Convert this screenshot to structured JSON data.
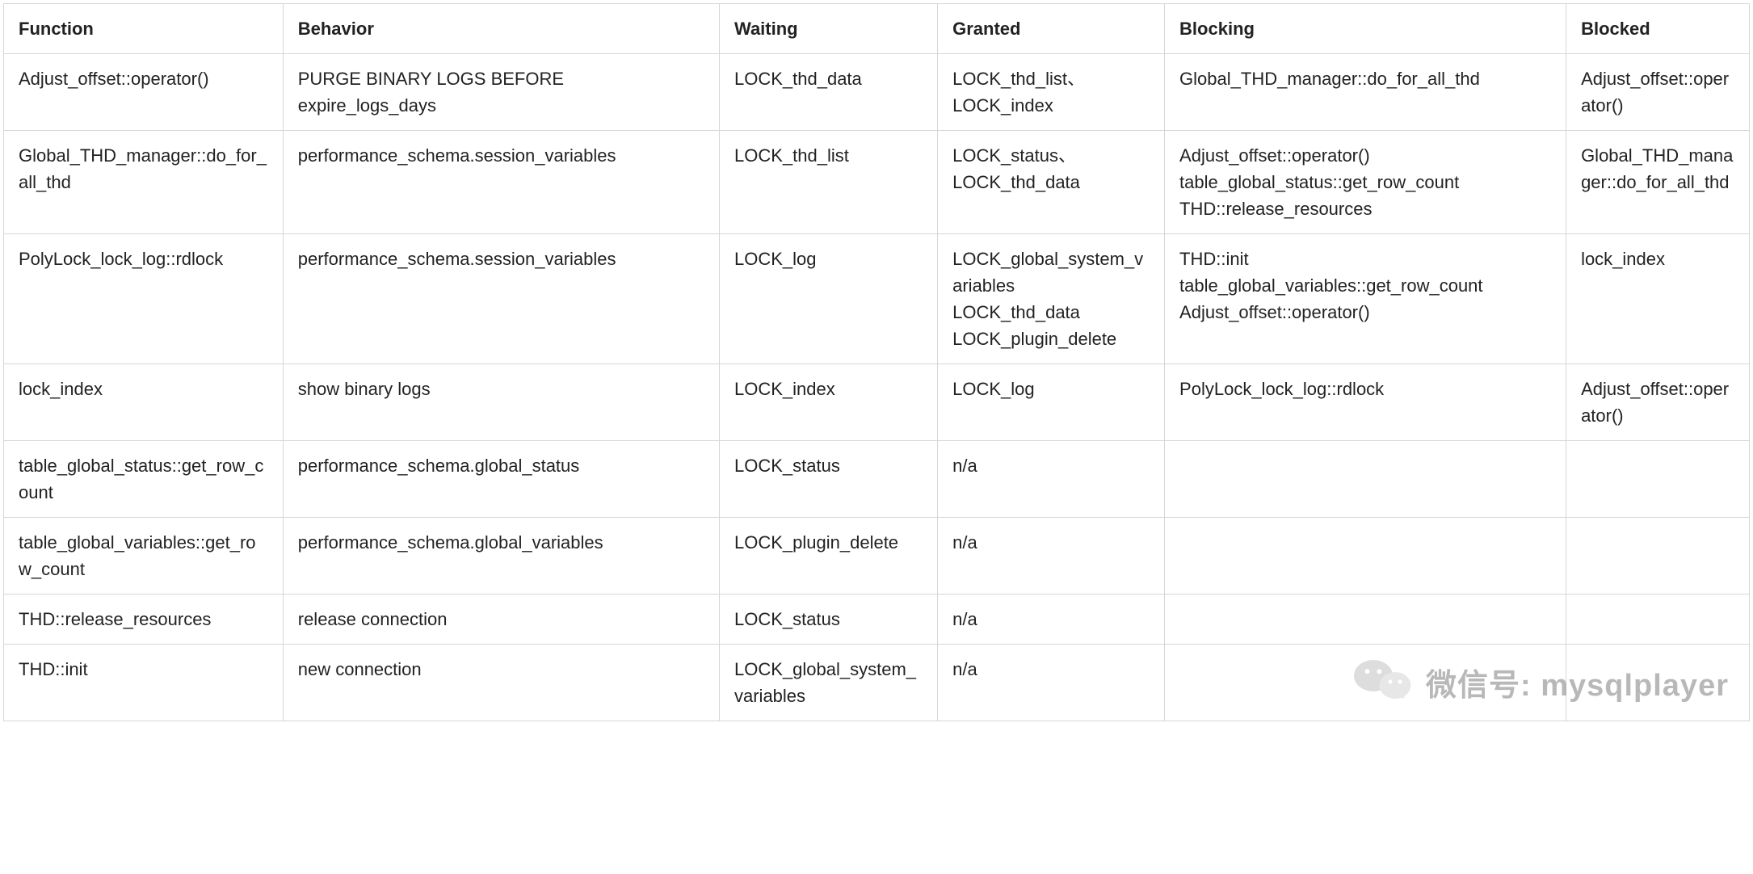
{
  "table": {
    "headers": {
      "function": "Function",
      "behavior": "Behavior",
      "waiting": "Waiting",
      "granted": "Granted",
      "blocking": "Blocking",
      "blocked": "Blocked"
    },
    "rows": [
      {
        "function": "Adjust_offset::operator()",
        "behavior": "PURGE BINARY LOGS BEFORE expire_logs_days",
        "waiting": "LOCK_thd_data",
        "granted": "LOCK_thd_list、LOCK_index",
        "blocking": "Global_THD_manager::do_for_all_thd",
        "blocked": "Adjust_offset::operator()"
      },
      {
        "function": "Global_THD_manager::do_for_all_thd",
        "behavior": "performance_schema.session_variables",
        "waiting": "LOCK_thd_list",
        "granted": "LOCK_status、LOCK_thd_data",
        "blocking_lines": [
          "Adjust_offset::operator()",
          "table_global_status::get_row_count",
          "THD::release_resources"
        ],
        "blocked": "Global_THD_manager::do_for_all_thd"
      },
      {
        "function": "PolyLock_lock_log::rdlock",
        "behavior": "performance_schema.session_variables",
        "waiting": "LOCK_log",
        "granted_lines": [
          "LOCK_global_system_variables",
          "LOCK_thd_data",
          "LOCK_plugin_delete"
        ],
        "blocking_lines": [
          "THD::init",
          "table_global_variables::get_row_count",
          "Adjust_offset::operator()"
        ],
        "blocked": "lock_index"
      },
      {
        "function": "lock_index",
        "behavior": "show binary logs",
        "waiting": "LOCK_index",
        "granted": "LOCK_log",
        "blocking": "PolyLock_lock_log::rdlock",
        "blocked": "Adjust_offset::operator()"
      },
      {
        "function": "table_global_status::get_row_count",
        "behavior": "performance_schema.global_status",
        "waiting": "LOCK_status",
        "granted": "n/a",
        "blocking": "",
        "blocked": ""
      },
      {
        "function": "table_global_variables::get_row_count",
        "behavior": "performance_schema.global_variables",
        "waiting": "LOCK_plugin_delete",
        "granted": "n/a",
        "blocking": "",
        "blocked": ""
      },
      {
        "function": "THD::release_resources",
        "behavior": "release connection",
        "waiting": "LOCK_status",
        "granted": "n/a",
        "blocking": "",
        "blocked": ""
      },
      {
        "function": "THD::init",
        "behavior": "new connection",
        "waiting": "LOCK_global_system_variables",
        "granted": "n/a",
        "blocking": "",
        "blocked": ""
      }
    ]
  },
  "watermark": {
    "label": "微信号:",
    "account": "mysqlplayer"
  }
}
